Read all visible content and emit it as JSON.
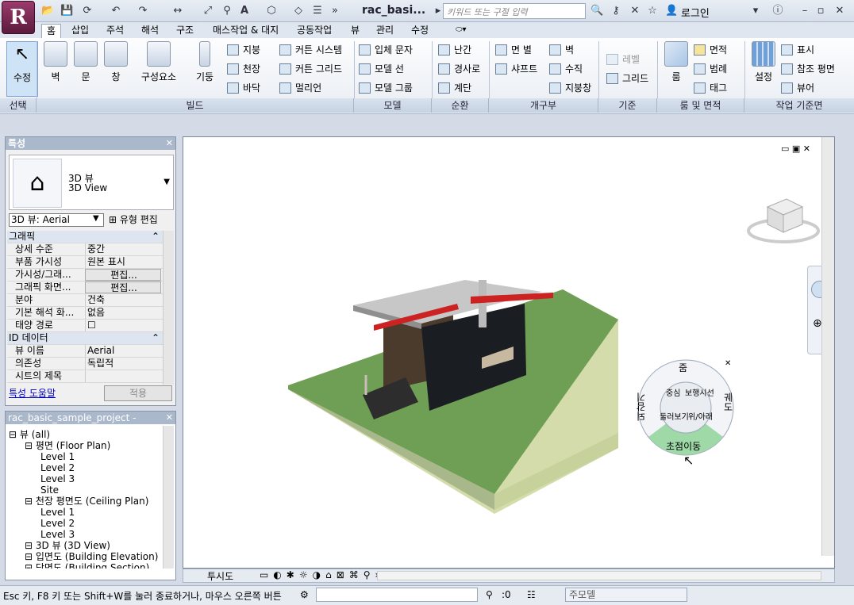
{
  "app": {
    "title": "rac_basi...",
    "logo": "R",
    "search_placeholder": "키워드 또는 구절 입력",
    "login": "로그인"
  },
  "tabs": [
    "홈",
    "삽입",
    "주석",
    "해석",
    "구조",
    "매스작업 & 대지",
    "공동작업",
    "뷰",
    "관리",
    "수정"
  ],
  "ribbon": {
    "select": {
      "big": "수정",
      "panel": "선택"
    },
    "build": {
      "big": [
        "벽",
        "문",
        "창",
        "구성요소",
        "기둥"
      ],
      "small1": [
        "지붕",
        "천장",
        "바닥"
      ],
      "small2": [
        "커튼 시스템",
        "커튼 그리드",
        "멀리언"
      ],
      "panel": "빌드"
    },
    "model": {
      "small": [
        "입체 문자",
        "모델 선",
        "모델 그룹"
      ],
      "panel": "모델"
    },
    "circulation": {
      "small": [
        "난간",
        "경사로",
        "계단"
      ],
      "panel": "순환"
    },
    "opening": {
      "small1": [
        "면 별",
        "샤프트"
      ],
      "small2": [
        "벽",
        "수직",
        "지붕창"
      ],
      "panel": "개구부"
    },
    "datum": {
      "small": [
        "레벨",
        "그리드"
      ],
      "panel": "기준"
    },
    "room": {
      "big": "룸",
      "small": [
        "면적",
        "범례",
        "태그"
      ],
      "panel": "룸 및 면적"
    },
    "workplane": {
      "big": "설정",
      "small": [
        "표시",
        "참조 평면",
        "뷰어"
      ],
      "panel": "작업 기준면"
    }
  },
  "properties": {
    "title": "특성",
    "type_line1": "3D 뷰",
    "type_line2": "3D View",
    "selector": "3D 뷰: Aerial",
    "edit_type": "유형 편집",
    "rows": [
      {
        "k": "그래픽",
        "v": "",
        "section": true
      },
      {
        "k": "상세 수준",
        "v": "중간"
      },
      {
        "k": "부품 가시성",
        "v": "원본 표시"
      },
      {
        "k": "가시성/그래...",
        "v": "편집...",
        "btn": true
      },
      {
        "k": "그래픽 화면...",
        "v": "편집...",
        "btn": true
      },
      {
        "k": "분야",
        "v": "건축"
      },
      {
        "k": "기본 해석 화...",
        "v": "없음"
      },
      {
        "k": "태양 경로",
        "v": "☐"
      },
      {
        "k": "ID 데이터",
        "v": "",
        "section": true
      },
      {
        "k": "뷰 이름",
        "v": "Aerial"
      },
      {
        "k": "의존성",
        "v": "독립적"
      },
      {
        "k": "시트의 제목",
        "v": ""
      }
    ],
    "help": "특성 도움말",
    "apply": "적용"
  },
  "browser": {
    "title": "rac_basic_sample_project -",
    "items": [
      {
        "t": "뷰 (all)",
        "d": 0
      },
      {
        "t": "평면 (Floor Plan)",
        "d": 1
      },
      {
        "t": "Level 1",
        "d": 2
      },
      {
        "t": "Level 2",
        "d": 2
      },
      {
        "t": "Level 3",
        "d": 2
      },
      {
        "t": "Site",
        "d": 2
      },
      {
        "t": "천장 평면도 (Ceiling Plan)",
        "d": 1
      },
      {
        "t": "Level 1",
        "d": 2
      },
      {
        "t": "Level 2",
        "d": 2
      },
      {
        "t": "Level 3",
        "d": 2
      },
      {
        "t": "3D 뷰 (3D View)",
        "d": 1
      },
      {
        "t": "입면도 (Building Elevation)",
        "d": 1
      },
      {
        "t": "단면도 (Building Section)",
        "d": 1
      }
    ]
  },
  "wheel": {
    "zoom": "줌",
    "rewind": "되감기",
    "pan": "초점이동",
    "orbit": "궤도",
    "center": "중심",
    "walk": "보행시선",
    "lookaround": "둘러보기",
    "updown": "위/아래"
  },
  "viewbar": {
    "label": "투시도"
  },
  "status": {
    "text": "Esc 키, F8 키 또는 Shift+W를 눌러 종료하거나, 마우스 오른쪽 버튼",
    "zero": ":0",
    "model": "주모델"
  },
  "colors": {
    "accent": "#7fcf8f",
    "grass": "#6a9a50",
    "roof": "#b8b8b8"
  }
}
